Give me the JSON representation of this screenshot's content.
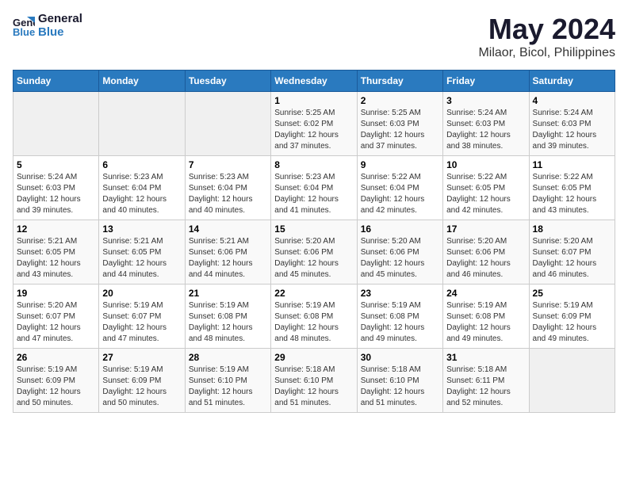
{
  "logo": {
    "line1": "General",
    "line2": "Blue"
  },
  "title": "May 2024",
  "subtitle": "Milaor, Bicol, Philippines",
  "weekdays": [
    "Sunday",
    "Monday",
    "Tuesday",
    "Wednesday",
    "Thursday",
    "Friday",
    "Saturday"
  ],
  "weeks": [
    [
      {
        "day": "",
        "info": ""
      },
      {
        "day": "",
        "info": ""
      },
      {
        "day": "",
        "info": ""
      },
      {
        "day": "1",
        "info": "Sunrise: 5:25 AM\nSunset: 6:02 PM\nDaylight: 12 hours\nand 37 minutes."
      },
      {
        "day": "2",
        "info": "Sunrise: 5:25 AM\nSunset: 6:03 PM\nDaylight: 12 hours\nand 37 minutes."
      },
      {
        "day": "3",
        "info": "Sunrise: 5:24 AM\nSunset: 6:03 PM\nDaylight: 12 hours\nand 38 minutes."
      },
      {
        "day": "4",
        "info": "Sunrise: 5:24 AM\nSunset: 6:03 PM\nDaylight: 12 hours\nand 39 minutes."
      }
    ],
    [
      {
        "day": "5",
        "info": "Sunrise: 5:24 AM\nSunset: 6:03 PM\nDaylight: 12 hours\nand 39 minutes."
      },
      {
        "day": "6",
        "info": "Sunrise: 5:23 AM\nSunset: 6:04 PM\nDaylight: 12 hours\nand 40 minutes."
      },
      {
        "day": "7",
        "info": "Sunrise: 5:23 AM\nSunset: 6:04 PM\nDaylight: 12 hours\nand 40 minutes."
      },
      {
        "day": "8",
        "info": "Sunrise: 5:23 AM\nSunset: 6:04 PM\nDaylight: 12 hours\nand 41 minutes."
      },
      {
        "day": "9",
        "info": "Sunrise: 5:22 AM\nSunset: 6:04 PM\nDaylight: 12 hours\nand 42 minutes."
      },
      {
        "day": "10",
        "info": "Sunrise: 5:22 AM\nSunset: 6:05 PM\nDaylight: 12 hours\nand 42 minutes."
      },
      {
        "day": "11",
        "info": "Sunrise: 5:22 AM\nSunset: 6:05 PM\nDaylight: 12 hours\nand 43 minutes."
      }
    ],
    [
      {
        "day": "12",
        "info": "Sunrise: 5:21 AM\nSunset: 6:05 PM\nDaylight: 12 hours\nand 43 minutes."
      },
      {
        "day": "13",
        "info": "Sunrise: 5:21 AM\nSunset: 6:05 PM\nDaylight: 12 hours\nand 44 minutes."
      },
      {
        "day": "14",
        "info": "Sunrise: 5:21 AM\nSunset: 6:06 PM\nDaylight: 12 hours\nand 44 minutes."
      },
      {
        "day": "15",
        "info": "Sunrise: 5:20 AM\nSunset: 6:06 PM\nDaylight: 12 hours\nand 45 minutes."
      },
      {
        "day": "16",
        "info": "Sunrise: 5:20 AM\nSunset: 6:06 PM\nDaylight: 12 hours\nand 45 minutes."
      },
      {
        "day": "17",
        "info": "Sunrise: 5:20 AM\nSunset: 6:06 PM\nDaylight: 12 hours\nand 46 minutes."
      },
      {
        "day": "18",
        "info": "Sunrise: 5:20 AM\nSunset: 6:07 PM\nDaylight: 12 hours\nand 46 minutes."
      }
    ],
    [
      {
        "day": "19",
        "info": "Sunrise: 5:20 AM\nSunset: 6:07 PM\nDaylight: 12 hours\nand 47 minutes."
      },
      {
        "day": "20",
        "info": "Sunrise: 5:19 AM\nSunset: 6:07 PM\nDaylight: 12 hours\nand 47 minutes."
      },
      {
        "day": "21",
        "info": "Sunrise: 5:19 AM\nSunset: 6:08 PM\nDaylight: 12 hours\nand 48 minutes."
      },
      {
        "day": "22",
        "info": "Sunrise: 5:19 AM\nSunset: 6:08 PM\nDaylight: 12 hours\nand 48 minutes."
      },
      {
        "day": "23",
        "info": "Sunrise: 5:19 AM\nSunset: 6:08 PM\nDaylight: 12 hours\nand 49 minutes."
      },
      {
        "day": "24",
        "info": "Sunrise: 5:19 AM\nSunset: 6:08 PM\nDaylight: 12 hours\nand 49 minutes."
      },
      {
        "day": "25",
        "info": "Sunrise: 5:19 AM\nSunset: 6:09 PM\nDaylight: 12 hours\nand 49 minutes."
      }
    ],
    [
      {
        "day": "26",
        "info": "Sunrise: 5:19 AM\nSunset: 6:09 PM\nDaylight: 12 hours\nand 50 minutes."
      },
      {
        "day": "27",
        "info": "Sunrise: 5:19 AM\nSunset: 6:09 PM\nDaylight: 12 hours\nand 50 minutes."
      },
      {
        "day": "28",
        "info": "Sunrise: 5:19 AM\nSunset: 6:10 PM\nDaylight: 12 hours\nand 51 minutes."
      },
      {
        "day": "29",
        "info": "Sunrise: 5:18 AM\nSunset: 6:10 PM\nDaylight: 12 hours\nand 51 minutes."
      },
      {
        "day": "30",
        "info": "Sunrise: 5:18 AM\nSunset: 6:10 PM\nDaylight: 12 hours\nand 51 minutes."
      },
      {
        "day": "31",
        "info": "Sunrise: 5:18 AM\nSunset: 6:11 PM\nDaylight: 12 hours\nand 52 minutes."
      },
      {
        "day": "",
        "info": ""
      }
    ]
  ]
}
